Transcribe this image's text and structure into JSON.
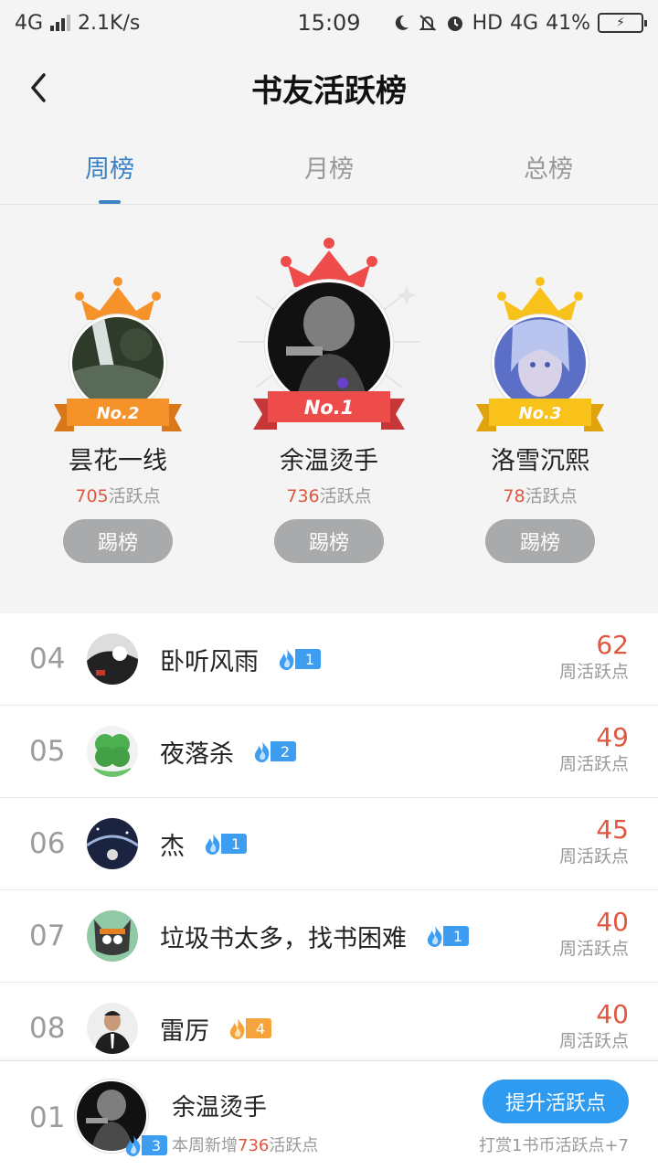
{
  "status_bar": {
    "network": "4G",
    "speed": "2.1K/s",
    "time": "15:09",
    "hd": "HD",
    "net2": "4G",
    "battery": "41%"
  },
  "header": {
    "title": "书友活跃榜"
  },
  "tabs": [
    {
      "label": "周榜",
      "active": true
    },
    {
      "label": "月榜",
      "active": false
    },
    {
      "label": "总榜",
      "active": false
    }
  ],
  "podium": {
    "second": {
      "rank_label": "No.2",
      "name": "昙花一线",
      "points": "705",
      "points_suffix": "活跃点",
      "button": "踢榜",
      "color": "#f5932a"
    },
    "first": {
      "rank_label": "No.1",
      "name": "余温烫手",
      "points": "736",
      "points_suffix": "活跃点",
      "button": "踢榜",
      "color": "#ee4b4b"
    },
    "third": {
      "rank_label": "No.3",
      "name": "洛雪沉熙",
      "points": "78",
      "points_suffix": "活跃点",
      "button": "踢榜",
      "color": "#f9c21b"
    }
  },
  "list": [
    {
      "rank": "04",
      "name": "卧听风雨",
      "level": "1",
      "level_color": "blue",
      "score": "62",
      "score_label": "周活跃点"
    },
    {
      "rank": "05",
      "name": "夜落杀",
      "level": "2",
      "level_color": "blue",
      "score": "49",
      "score_label": "周活跃点"
    },
    {
      "rank": "06",
      "name": "杰",
      "level": "1",
      "level_color": "blue",
      "score": "45",
      "score_label": "周活跃点"
    },
    {
      "rank": "07",
      "name": "垃圾书太多，找书困难",
      "level": "1",
      "level_color": "blue",
      "score": "40",
      "score_label": "周活跃点"
    },
    {
      "rank": "08",
      "name": "雷厉",
      "level": "4",
      "level_color": "orange",
      "score": "40",
      "score_label": "周活跃点"
    }
  ],
  "me": {
    "rank": "01",
    "name": "余温烫手",
    "level": "3",
    "sub_prefix": "本周新增",
    "sub_value": "736",
    "sub_suffix": "活跃点",
    "button": "提升活跃点",
    "tip": "打赏1书币活跃点+7"
  },
  "colors": {
    "accent": "#3b82c4",
    "score": "#e0573f",
    "button_blue": "#2e9bf0"
  }
}
